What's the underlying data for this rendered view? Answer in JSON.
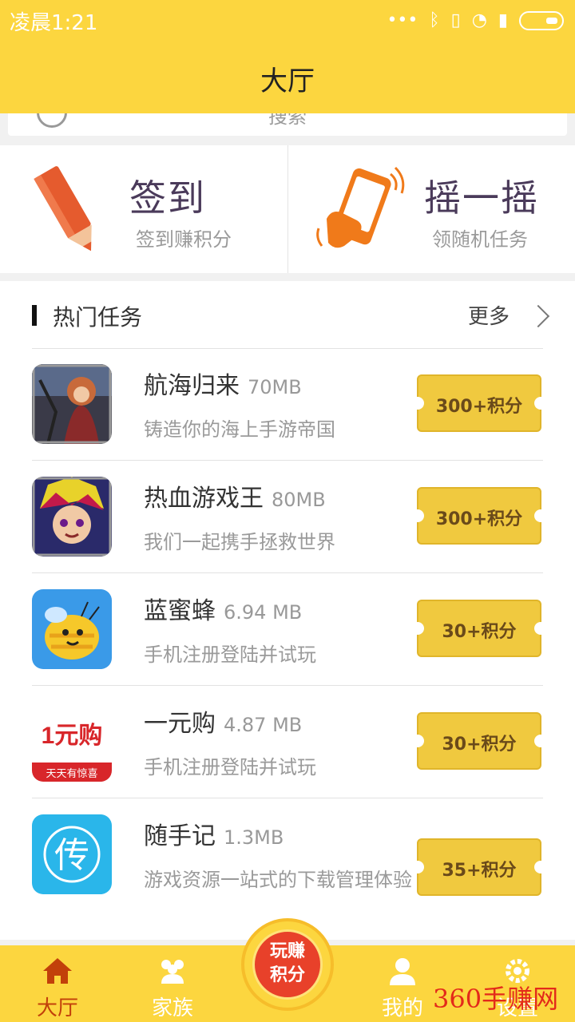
{
  "status_bar": {
    "time": "凌晨1:21"
  },
  "header": {
    "title": "大厅"
  },
  "search": {
    "placeholder": "搜索"
  },
  "quick_actions": [
    {
      "title": "签到",
      "subtitle": "签到赚积分",
      "icon": "pencil-icon"
    },
    {
      "title": "摇一摇",
      "subtitle": "领随机任务",
      "icon": "shake-phone-icon"
    }
  ],
  "hot_tasks": {
    "title": "热门任务",
    "more_label": "更多",
    "items": [
      {
        "name": "航海归来",
        "size": "70MB",
        "desc": "铸造你的海上手游帝国",
        "reward": "300+积分"
      },
      {
        "name": "热血游戏王",
        "size": "80MB",
        "desc": "我们一起携手拯救世界",
        "reward": "300+积分"
      },
      {
        "name": "蓝蜜蜂",
        "size": "6.94 MB",
        "desc": "手机注册登陆并试玩",
        "reward": "30+积分"
      },
      {
        "name": "一元购",
        "size": "4.87 MB",
        "desc": "手机注册登陆并试玩",
        "reward": "30+积分"
      },
      {
        "name": "随手记",
        "size": "1.3MB",
        "desc": "游戏资源一站式的下载管理体验",
        "reward": "35+积分"
      }
    ]
  },
  "tabbar": {
    "tabs": [
      {
        "label": "大厅",
        "icon": "home-icon",
        "active": true
      },
      {
        "label": "家族",
        "icon": "family-icon",
        "active": false
      },
      {
        "label": "我的",
        "icon": "user-icon",
        "active": false
      },
      {
        "label": "设置",
        "icon": "settings-icon",
        "active": false
      }
    ],
    "center_label_1": "玩赚",
    "center_label_2": "积分"
  },
  "icon_texts": {
    "yiyuangou_logo": "1元购",
    "yiyuangou_slogan": "天天有惊喜",
    "suishouji_logo": "传"
  },
  "watermark": "360手赚网",
  "colors": {
    "header": "#fcd63f",
    "ticket": "#f0c93f",
    "active_tab": "#c2400a"
  }
}
